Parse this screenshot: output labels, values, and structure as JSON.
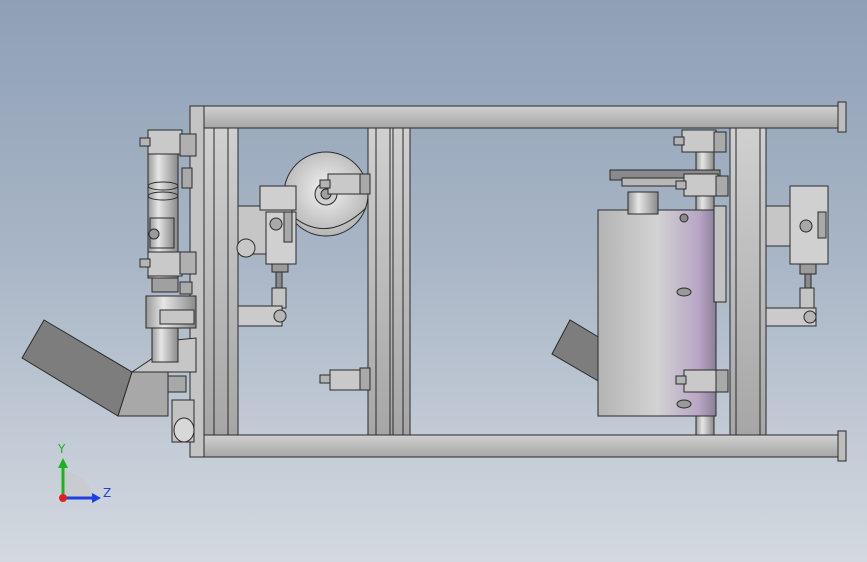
{
  "viewport": {
    "background_top": "#8fa0b6",
    "background_bottom": "#d4d9e0"
  },
  "model": {
    "part_color": "#bdbdbd",
    "edge_color": "#2a2a2a",
    "shade_color": "#8e8e8e"
  },
  "triad": {
    "y_label": "Y",
    "z_label": "Z",
    "y_color": "#20b020",
    "z_color": "#2040e0",
    "x_color": "#e02020"
  }
}
